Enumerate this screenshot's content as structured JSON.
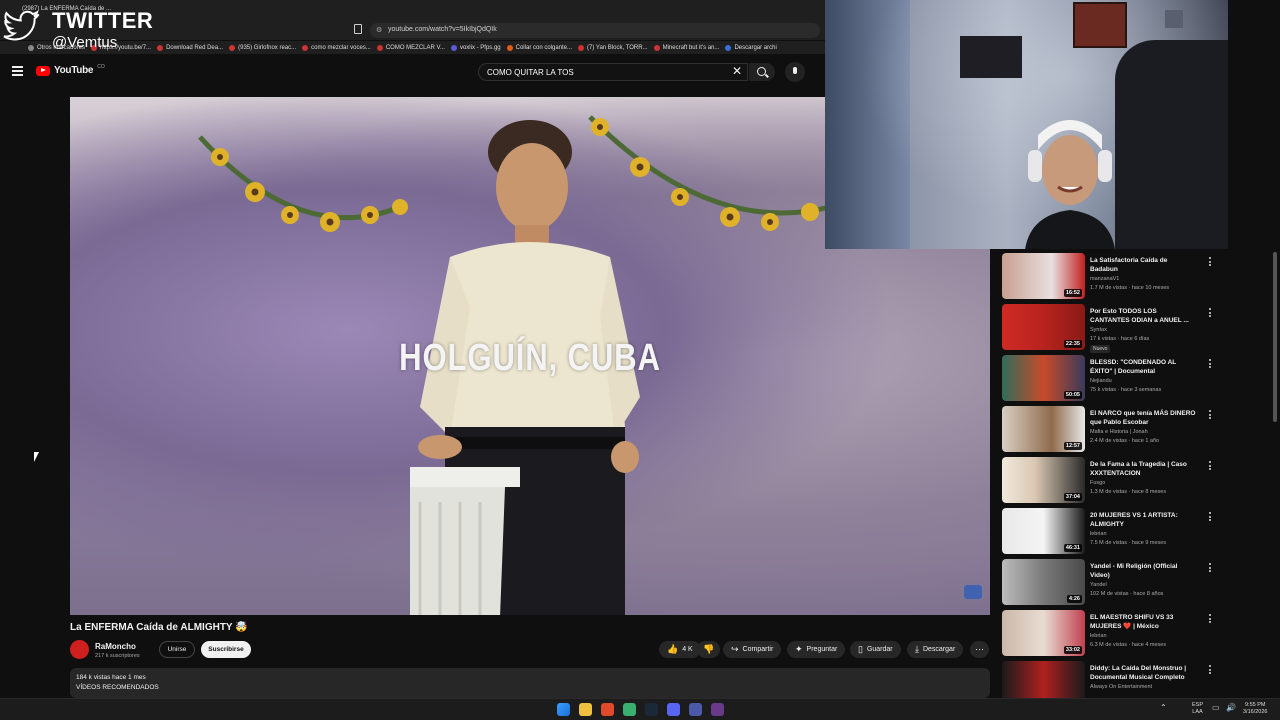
{
  "browser": {
    "tab_title": "(2987) La ENFERMA Caída de ...",
    "url": "youtube.com/watch?v=5IkIbjQdQIk",
    "bookmarks": [
      "Otros marcadores",
      "https://youtu.be/7...",
      "Download Red Dea...",
      "(935) Girlofnox reac...",
      "como mezclar voces...",
      "COMO MEZCLAR V...",
      "voxlix - Pfps.gg",
      "Collar con colgante...",
      "(7) Yan Block, TORR...",
      "Minecraft but it's an...",
      "Descargar archi"
    ]
  },
  "overlay": {
    "title": "TWITTER",
    "handle": "@Vemtus"
  },
  "youtube": {
    "logo": "YouTube",
    "country": "CO",
    "search_value": "COMO QUITAR LA TOS"
  },
  "video": {
    "overlay_text": "HOLGUÍN, CUBA",
    "title": "La ENFERMA Caída de ALMIGHTY 🤯",
    "channel": "RaMoncho",
    "subscribers": "217 k suscriptores",
    "join_label": "Unirse",
    "subscribe_label": "Suscribirse",
    "likes": "4 K",
    "share_label": "Compartir",
    "ask_label": "Preguntar",
    "save_label": "Guardar",
    "download_label": "Descargar",
    "description": {
      "stats": "184 k vistas  hace 1 mes",
      "line2": "VÍDEOS RECOMENDADOS"
    }
  },
  "recommendations": [
    {
      "title": "La Satisfactoria Caída de Badabun",
      "channel": "manzanaV1",
      "meta": "1.7 M de vistas · hace 10 meses",
      "duration": "16:52",
      "color": "#c8a090"
    },
    {
      "title": "Por Esto TODOS LOS CANTANTES ODIAN a ANUEL ...",
      "channel": "Syntax",
      "meta": "17 k vistas · hace 6 días",
      "badge": "Nuevo",
      "duration": "22:35",
      "color": "#b8231f"
    },
    {
      "title": "BLESSD: \"CONDENADO AL ÉXITO\" | Documental",
      "channel": "Nejiandu",
      "meta": "75 k vistas · hace 3 semanas",
      "duration": "50:05",
      "color": "#2f6d5b"
    },
    {
      "title": "El NARCO que tenía MÁS DINERO que Pablo Escobar",
      "channel": "Mafia e Historia | Jonah",
      "meta": "2.4 M de vistas · hace 1 año",
      "duration": "12:57",
      "color": "#8f6b4c"
    },
    {
      "title": "De la Fama a la Tragedia | Caso XXXTENTACION",
      "channel": "Fusgo",
      "meta": "1.3 M de vistas · hace 8 meses",
      "duration": "37:04",
      "color": "#d9c7b2"
    },
    {
      "title": "20 MUJERES VS 1 ARTISTA: ALMIGHTY",
      "channel": "lebrian",
      "meta": "7.5 M de vistas · hace 9 meses",
      "duration": "46:31",
      "color": "#e8e8e8"
    },
    {
      "title": "Yandel - Mi Religión (Official Video)",
      "channel": "Yandel",
      "meta": "102 M de vistas · hace 8 años",
      "duration": "4:26",
      "color": "#9a9a9a"
    },
    {
      "title": "EL MAESTRO SHIFU VS 33 MUJERES ❤️ | México",
      "channel": "lebrian",
      "meta": "6.3 M de vistas · hace 4 meses",
      "duration": "33:02",
      "color": "#cbb8a8"
    },
    {
      "title": "Diddy: La Caída Del Monstruo | Documental Musical Completo",
      "channel": "Always On Entertainment",
      "meta": "",
      "duration": "",
      "color": "#b02020"
    }
  ],
  "taskbar": {
    "lang": "ESP",
    "region": "LAA",
    "time": "9:55 PM",
    "date": "3/16/2026"
  }
}
